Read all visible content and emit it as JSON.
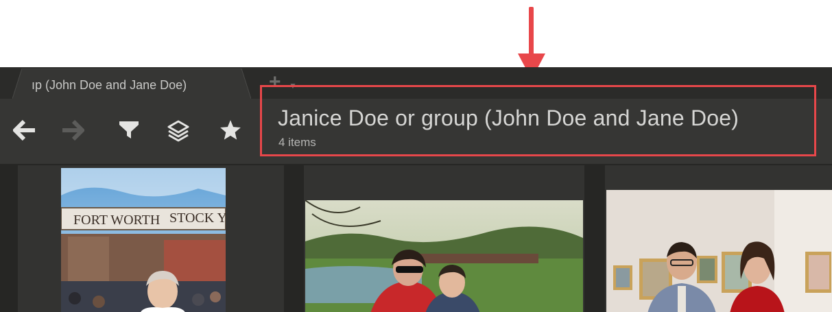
{
  "tab": {
    "label": "ıp (John Doe and Jane Doe)"
  },
  "tabbar": {
    "add_icon": "plus-icon",
    "add_menu_icon": "caret-down-icon"
  },
  "toolbar": {
    "icons": [
      "arrow-left-icon",
      "arrow-right-icon",
      "filter-icon",
      "layers-icon",
      "star-icon"
    ]
  },
  "view": {
    "title": "Janice Doe or group (John Doe and Jane Doe)",
    "item_count": "4 items"
  },
  "photos": {
    "photo_1": {
      "sign_text_1": "FORT WORTH",
      "sign_text_2": "STOCK Y"
    }
  },
  "colors": {
    "annotation": "#e8474a",
    "background": "#2e2e2c"
  }
}
